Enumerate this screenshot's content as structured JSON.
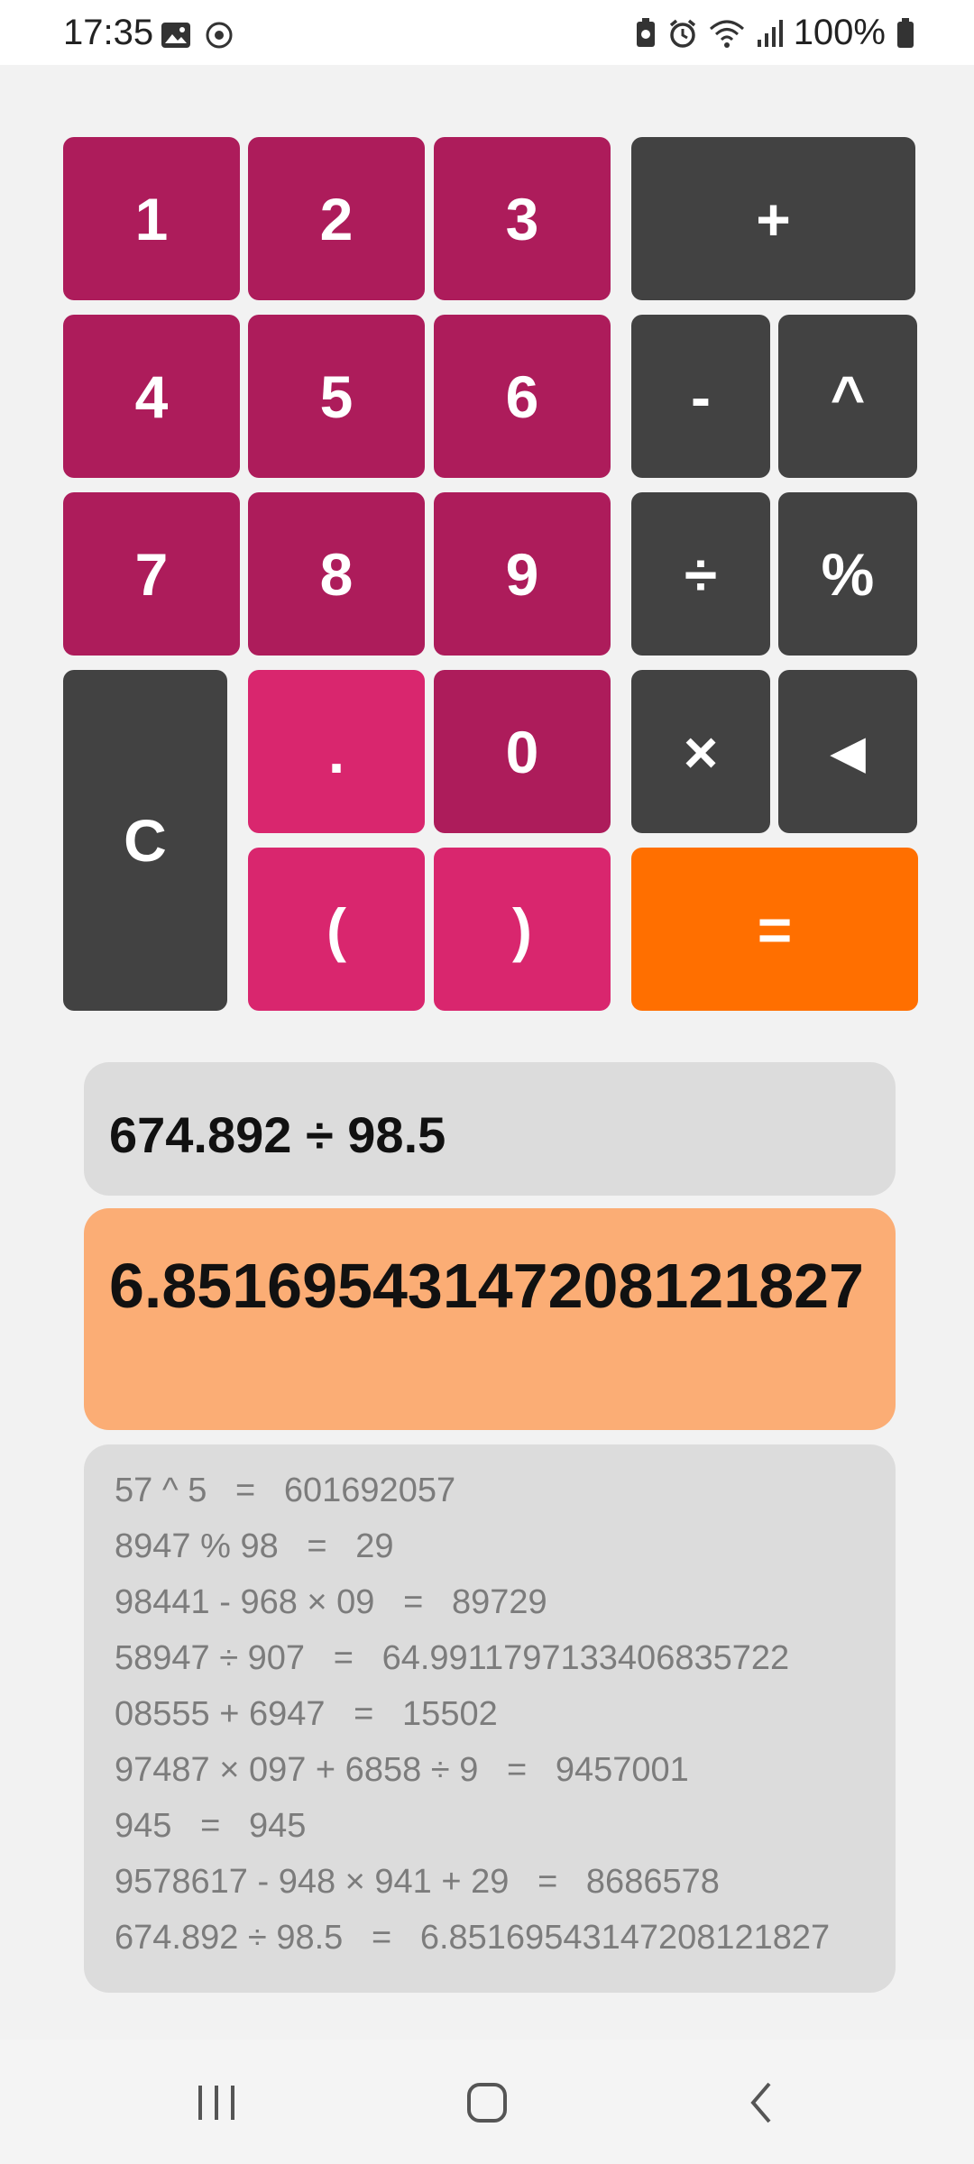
{
  "status_bar": {
    "time": "17:35",
    "battery": "100%",
    "left_icons": [
      "image-icon",
      "sync-icon"
    ],
    "right_icons": [
      "battery-saver-icon",
      "alarm-icon",
      "wifi-icon",
      "signal-icon",
      "battery-icon"
    ]
  },
  "keypad": {
    "k1": "1",
    "k2": "2",
    "k3": "3",
    "k4": "4",
    "k5": "5",
    "k6": "6",
    "k7": "7",
    "k8": "8",
    "k9": "9",
    "k0": "0",
    "dot": ".",
    "open_paren": "(",
    "close_paren": ")",
    "clear": "C",
    "plus": "+",
    "minus": "-",
    "power": "^",
    "divide": "÷",
    "percent": "%",
    "multiply": "×",
    "backspace": "◄",
    "equals": "="
  },
  "display": {
    "expression": "674.892 ÷ 98.5",
    "result": "6.85169543147208121827"
  },
  "history": [
    "57 ^ 5   =   601692057",
    "8947 % 98   =   29",
    "98441 - 968 × 09   =   89729",
    "58947 ÷ 907   =   64.9911797133406835722",
    "08555 + 6947   =   15502",
    "97487 × 097 + 6858 ÷ 9   =   9457001",
    "945   =   945",
    "9578617 - 948 × 941 + 29   =   8686578",
    "674.892 ÷ 98.5   =   6.85169543147208121827"
  ],
  "colors": {
    "number_key": "#ad1c5b",
    "light_key": "#d9266e",
    "operator_key": "#424242",
    "equals_key": "#ff6f00",
    "result_bg": "#fbad75",
    "panel_bg": "#dcdcdc"
  },
  "nav_bar": {
    "icons": [
      "recent-apps-icon",
      "home-icon",
      "back-icon"
    ]
  }
}
